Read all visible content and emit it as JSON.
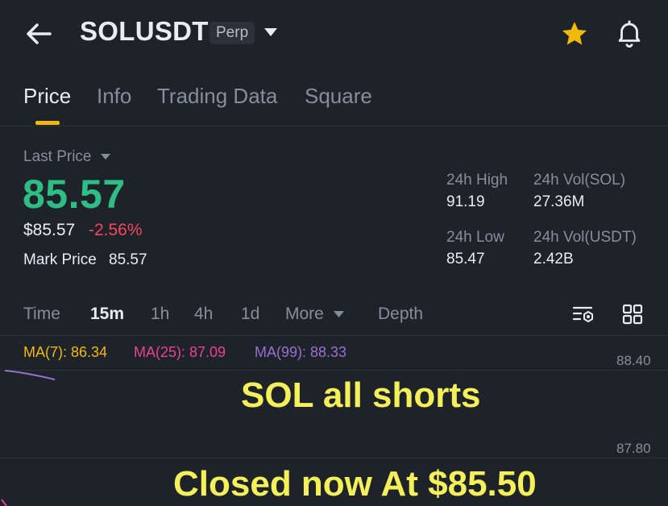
{
  "header": {
    "symbol": "SOLUSDT",
    "contract_type": "Perp"
  },
  "tabs": [
    {
      "label": "Price",
      "active": true
    },
    {
      "label": "Info"
    },
    {
      "label": "Trading Data"
    },
    {
      "label": "Square"
    }
  ],
  "price": {
    "last_price_label": "Last Price",
    "last_price": "85.57",
    "usd_price": "$85.57",
    "change_pct": "-2.56%",
    "mark_price_label": "Mark Price",
    "mark_price": "85.57"
  },
  "stats": {
    "high_24h_label": "24h High",
    "high_24h": "91.19",
    "vol_sol_label": "24h Vol(SOL)",
    "vol_sol": "27.36M",
    "low_24h_label": "24h Low",
    "low_24h": "85.47",
    "vol_usdt_label": "24h Vol(USDT)",
    "vol_usdt": "2.42B"
  },
  "intervals": {
    "time": "Time",
    "m15": "15m",
    "h1": "1h",
    "h4": "4h",
    "d1": "1d",
    "more": "More",
    "depth": "Depth",
    "selected": "15m"
  },
  "ma": {
    "ma7": "MA(7): 86.34",
    "ma25": "MA(25): 87.09",
    "ma99": "MA(99): 88.33"
  },
  "chart": {
    "axis_labels": [
      "88.40",
      "87.80"
    ]
  },
  "overlay": {
    "line1": "SOL all shorts",
    "line2": "Closed now At $85.50"
  },
  "colors": {
    "background": "#1e2329",
    "up": "#2ebd85",
    "down": "#f6465d",
    "accent": "#f0b90b",
    "overlay_text": "#f5f05a"
  },
  "icons": {
    "back": "back-arrow-icon",
    "dropdown": "caret-down-icon",
    "favorite": "star-icon",
    "alert": "bell-icon",
    "indicators": "indicator-settings-icon",
    "layout": "grid-icon"
  }
}
